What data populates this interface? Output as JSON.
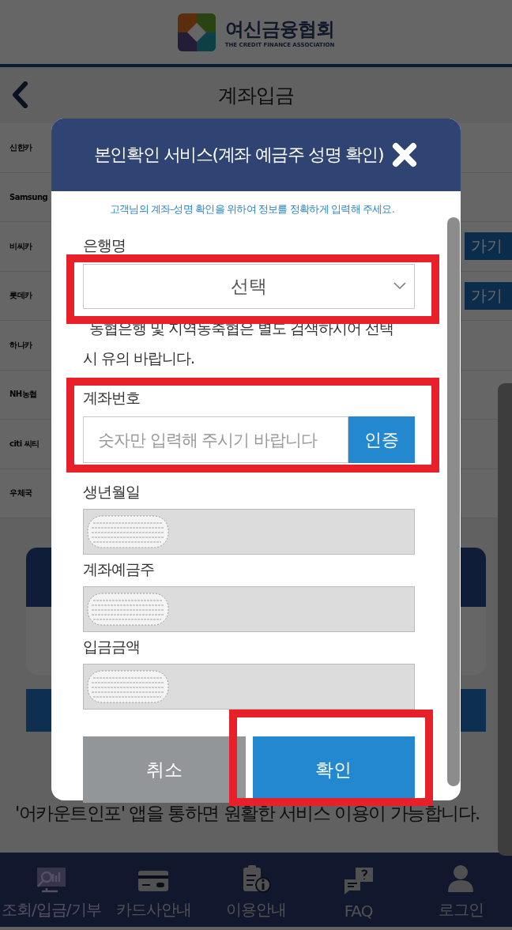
{
  "header": {
    "logo_title": "여신금융협회",
    "logo_subtitle": "THE CREDIT FINANCE ASSOCIATION"
  },
  "page": {
    "title": "계좌입금",
    "card_rows": [
      {
        "name": "신한카"
      },
      {
        "name": "Samsung"
      },
      {
        "name": "비씨카",
        "button": "가기"
      },
      {
        "name": "롯데카",
        "button": "가기"
      },
      {
        "name": "하나카"
      },
      {
        "name": "NH농협"
      },
      {
        "name": "citi 씨티"
      },
      {
        "name": "우체국"
      }
    ],
    "notice": "'어카운트인포' 앱을 통하면 원활한 서비스 이용이 가능합니다."
  },
  "modal": {
    "title": "본인확인 서비스(계좌 예금주 성명 확인)",
    "intro": "고객님의 계좌-성명 확인을 위하여 정보를 정확하게 입력해 주세요.",
    "bank": {
      "label": "은행명",
      "value": "선택"
    },
    "bank_notice": [
      "농협은행 및 지역농축협은 별도 검색하시어 선택",
      "시 유의 바랍니다."
    ],
    "account": {
      "label": "계좌번호",
      "placeholder": "숫자만 입력해 주시기 바랍니다",
      "button": "인증"
    },
    "fields": [
      {
        "label": "생년월일",
        "masked": true
      },
      {
        "label": "계좌예금주",
        "masked": true
      },
      {
        "label": "입금금액",
        "masked": true
      }
    ],
    "buttons": [
      {
        "label": "취소",
        "kind": "cancel"
      },
      {
        "label": "확인",
        "kind": "confirm"
      }
    ]
  },
  "bottom_nav": [
    {
      "label": "조회/입금/기부",
      "selected": true
    },
    {
      "label": "카드사안내",
      "selected": false
    },
    {
      "label": "이용안내",
      "selected": false
    },
    {
      "label": "FAQ",
      "selected": false
    },
    {
      "label": "로그인",
      "selected": false
    }
  ]
}
